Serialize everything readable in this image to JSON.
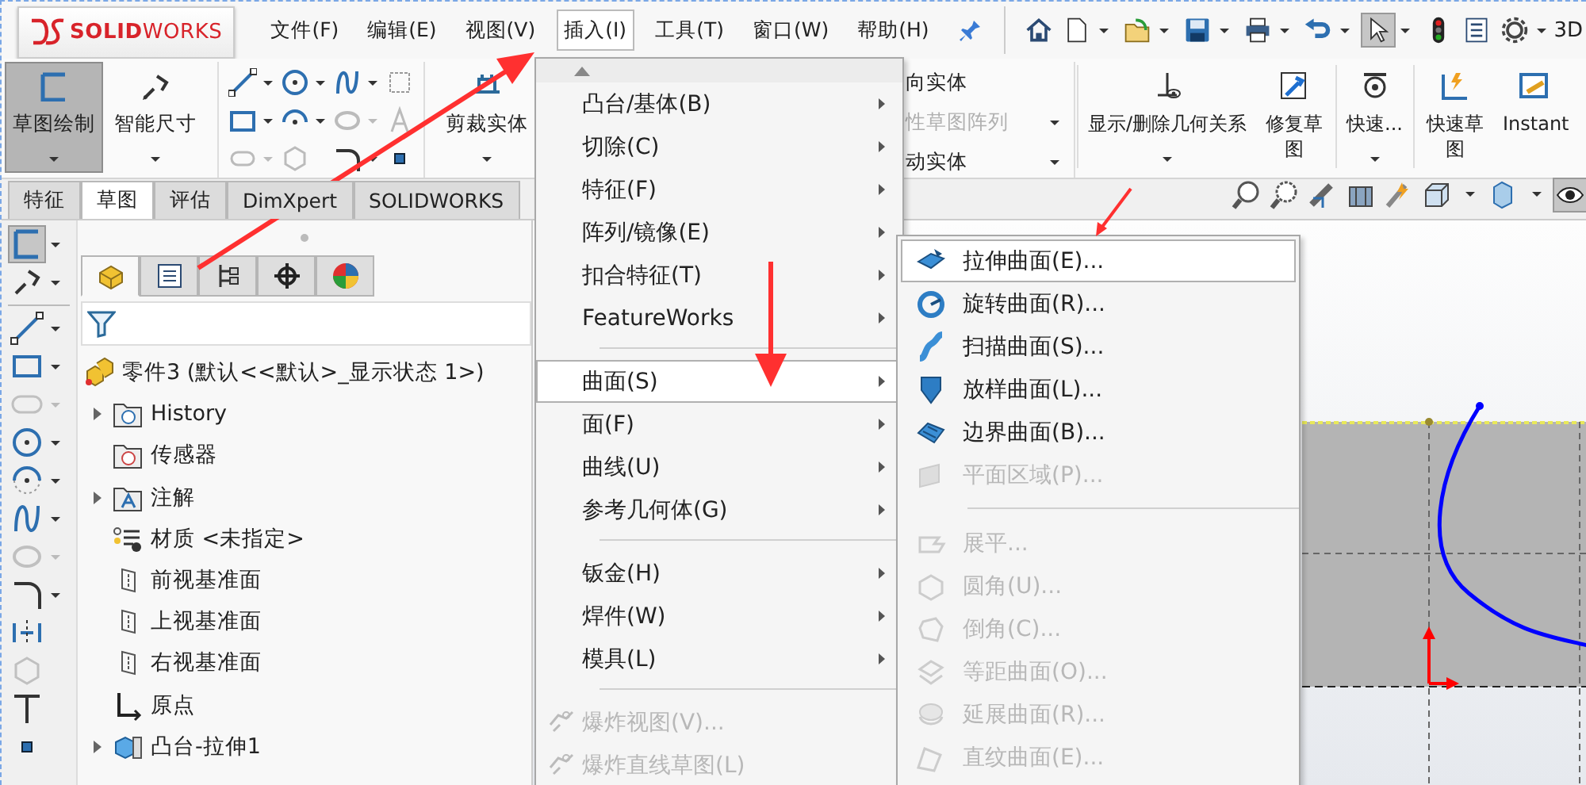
{
  "menubar": {
    "logo": "**SOLID**WORKS",
    "items": [
      {
        "label": "文件(F)",
        "selected": false
      },
      {
        "label": "编辑(E)",
        "selected": false
      },
      {
        "label": "视图(V)",
        "selected": false
      },
      {
        "label": "插入(I)",
        "selected": true
      },
      {
        "label": "工具(T)",
        "selected": false
      },
      {
        "label": "窗口(W)",
        "selected": false
      },
      {
        "label": "帮助(H)",
        "selected": false
      }
    ],
    "quick_toolbar": [
      {
        "selected": false,
        "dropdown": false
      },
      {
        "selected": false,
        "dropdown": true
      },
      {
        "selected": false,
        "dropdown": true
      },
      {
        "selected": false,
        "dropdown": true
      },
      {
        "selected": false,
        "dropdown": true
      },
      {
        "selected": false,
        "dropdown": true
      },
      {
        "selected": true,
        "dropdown": true
      },
      {
        "selected": false,
        "dropdown": false
      },
      {
        "selected": false,
        "dropdown": false
      },
      {
        "selected": false,
        "dropdown": true
      }
    ],
    "title_fragment": "3D"
  },
  "ribbon": {
    "left": [
      {
        "kind": "big",
        "label": "草图绘制",
        "selected": true,
        "dropdown": true
      },
      {
        "kind": "big",
        "label": "智能尺寸",
        "selected": false,
        "dropdown": true
      },
      {
        "kind": "tool_grid"
      },
      {
        "kind": "big",
        "label": "剪裁实体",
        "selected": false,
        "dropdown": true
      }
    ],
    "right": [
      {
        "kind": "list",
        "items": [
          {
            "label": "向实体",
            "disabled": false,
            "dropdown": false
          },
          {
            "label": "性草图阵列",
            "disabled": true,
            "dropdown": true
          },
          {
            "label": "动实体",
            "disabled": false,
            "dropdown": true
          }
        ]
      },
      {
        "kind": "big",
        "label": "显示/删除几何关系",
        "selected": false,
        "dropdown": true
      },
      {
        "kind": "big",
        "label": "修复草图",
        "selected": false,
        "dropdown": false
      },
      {
        "kind": "big",
        "label": "快速...",
        "selected": false,
        "dropdown": true
      },
      {
        "kind": "big",
        "label": "快速草图",
        "selected": false,
        "dropdown": false
      },
      {
        "kind": "big",
        "label": "Instant",
        "selected": false,
        "dropdown": false
      }
    ]
  },
  "command_tabs": [
    {
      "label": "特征",
      "selected": false
    },
    {
      "label": "草图",
      "selected": true
    },
    {
      "label": "评估",
      "selected": false
    },
    {
      "label": "DimXpert",
      "selected": false
    },
    {
      "label": "SOLIDWORKS",
      "selected": false
    }
  ],
  "sketch_toolbar": [
    {
      "selected": true,
      "disabled": false,
      "dropdown": true
    },
    {
      "selected": false,
      "disabled": false,
      "dropdown": true
    },
    {
      "selected": false,
      "disabled": false,
      "dropdown": true
    },
    {
      "selected": false,
      "disabled": false,
      "dropdown": true
    },
    {
      "selected": false,
      "disabled": true,
      "dropdown": true
    },
    {
      "selected": false,
      "disabled": false,
      "dropdown": true
    },
    {
      "selected": false,
      "disabled": false,
      "dropdown": true
    },
    {
      "selected": false,
      "disabled": false,
      "dropdown": true
    },
    {
      "selected": false,
      "disabled": true,
      "dropdown": true
    },
    {
      "selected": false,
      "disabled": false,
      "dropdown": true
    },
    {
      "selected": false,
      "disabled": false,
      "dropdown": false
    },
    {
      "selected": false,
      "disabled": true,
      "dropdown": false
    },
    {
      "selected": false,
      "disabled": false,
      "dropdown": false
    },
    {
      "selected": false,
      "disabled": false,
      "dropdown": false
    }
  ],
  "feature_manager": {
    "tabs": [
      {
        "selected": true
      },
      {
        "selected": false
      },
      {
        "selected": false
      },
      {
        "selected": false
      },
      {
        "selected": false
      }
    ],
    "tree": [
      {
        "label": "零件3  (默认<<默认>_显示状态 1>)",
        "expander": false,
        "children": [
          {
            "label": "History",
            "expander": true
          },
          {
            "label": "传感器",
            "expander": false
          },
          {
            "label": "注解",
            "expander": true
          },
          {
            "label": "材质 <未指定>",
            "expander": false
          },
          {
            "label": "前视基准面",
            "expander": false
          },
          {
            "label": "上视基准面",
            "expander": false
          },
          {
            "label": "右视基准面",
            "expander": false
          },
          {
            "label": "原点",
            "expander": false
          },
          {
            "label": "凸台-拉伸1",
            "expander": true
          }
        ]
      }
    ]
  },
  "insert_menu": {
    "items": [
      {
        "kind": "scroll_up"
      },
      {
        "kind": "item",
        "label": "凸台/基体(B)",
        "submenu": true,
        "selected": false,
        "disabled": false
      },
      {
        "kind": "item",
        "label": "切除(C)",
        "submenu": true,
        "selected": false,
        "disabled": false
      },
      {
        "kind": "item",
        "label": "特征(F)",
        "submenu": true,
        "selected": false,
        "disabled": false
      },
      {
        "kind": "item",
        "label": "阵列/镜像(E)",
        "submenu": true,
        "selected": false,
        "disabled": false
      },
      {
        "kind": "item",
        "label": "扣合特征(T)",
        "submenu": true,
        "selected": false,
        "disabled": false
      },
      {
        "kind": "item",
        "label": "FeatureWorks",
        "submenu": true,
        "selected": false,
        "disabled": false
      },
      {
        "kind": "separator"
      },
      {
        "kind": "item",
        "label": "曲面(S)",
        "submenu": true,
        "selected": true,
        "disabled": false
      },
      {
        "kind": "item",
        "label": "面(F)",
        "submenu": true,
        "selected": false,
        "disabled": false
      },
      {
        "kind": "item",
        "label": "曲线(U)",
        "submenu": true,
        "selected": false,
        "disabled": false
      },
      {
        "kind": "item",
        "label": "参考几何体(G)",
        "submenu": true,
        "selected": false,
        "disabled": false
      },
      {
        "kind": "separator"
      },
      {
        "kind": "item",
        "label": "钣金(H)",
        "submenu": true,
        "selected": false,
        "disabled": false
      },
      {
        "kind": "item",
        "label": "焊件(W)",
        "submenu": true,
        "selected": false,
        "disabled": false
      },
      {
        "kind": "item",
        "label": "模具(L)",
        "submenu": true,
        "selected": false,
        "disabled": false
      },
      {
        "kind": "separator"
      },
      {
        "kind": "item",
        "label": "爆炸视图(V)...",
        "submenu": false,
        "selected": false,
        "disabled": true,
        "icon": true
      },
      {
        "kind": "item",
        "label": "爆炸直线草图(L)",
        "submenu": false,
        "selected": false,
        "disabled": true,
        "icon": true
      }
    ]
  },
  "surface_submenu": {
    "items": [
      {
        "kind": "item",
        "label": "拉伸曲面(E)...",
        "selected": true,
        "disabled": false
      },
      {
        "kind": "item",
        "label": "旋转曲面(R)...",
        "selected": false,
        "disabled": false
      },
      {
        "kind": "item",
        "label": "扫描曲面(S)...",
        "selected": false,
        "disabled": false
      },
      {
        "kind": "item",
        "label": "放样曲面(L)...",
        "selected": false,
        "disabled": false
      },
      {
        "kind": "item",
        "label": "边界曲面(B)...",
        "selected": false,
        "disabled": false
      },
      {
        "kind": "item",
        "label": "平面区域(P)...",
        "selected": false,
        "disabled": true
      },
      {
        "kind": "separator"
      },
      {
        "kind": "item",
        "label": "展平...",
        "selected": false,
        "disabled": true
      },
      {
        "kind": "item",
        "label": "圆角(U)...",
        "selected": false,
        "disabled": true
      },
      {
        "kind": "item",
        "label": "倒角(C)...",
        "selected": false,
        "disabled": true
      },
      {
        "kind": "item",
        "label": "等距曲面(O)...",
        "selected": false,
        "disabled": true
      },
      {
        "kind": "item",
        "label": "延展曲面(R)...",
        "selected": false,
        "disabled": true
      },
      {
        "kind": "item",
        "label": "直纹曲面(E)...",
        "selected": false,
        "disabled": true
      }
    ]
  }
}
